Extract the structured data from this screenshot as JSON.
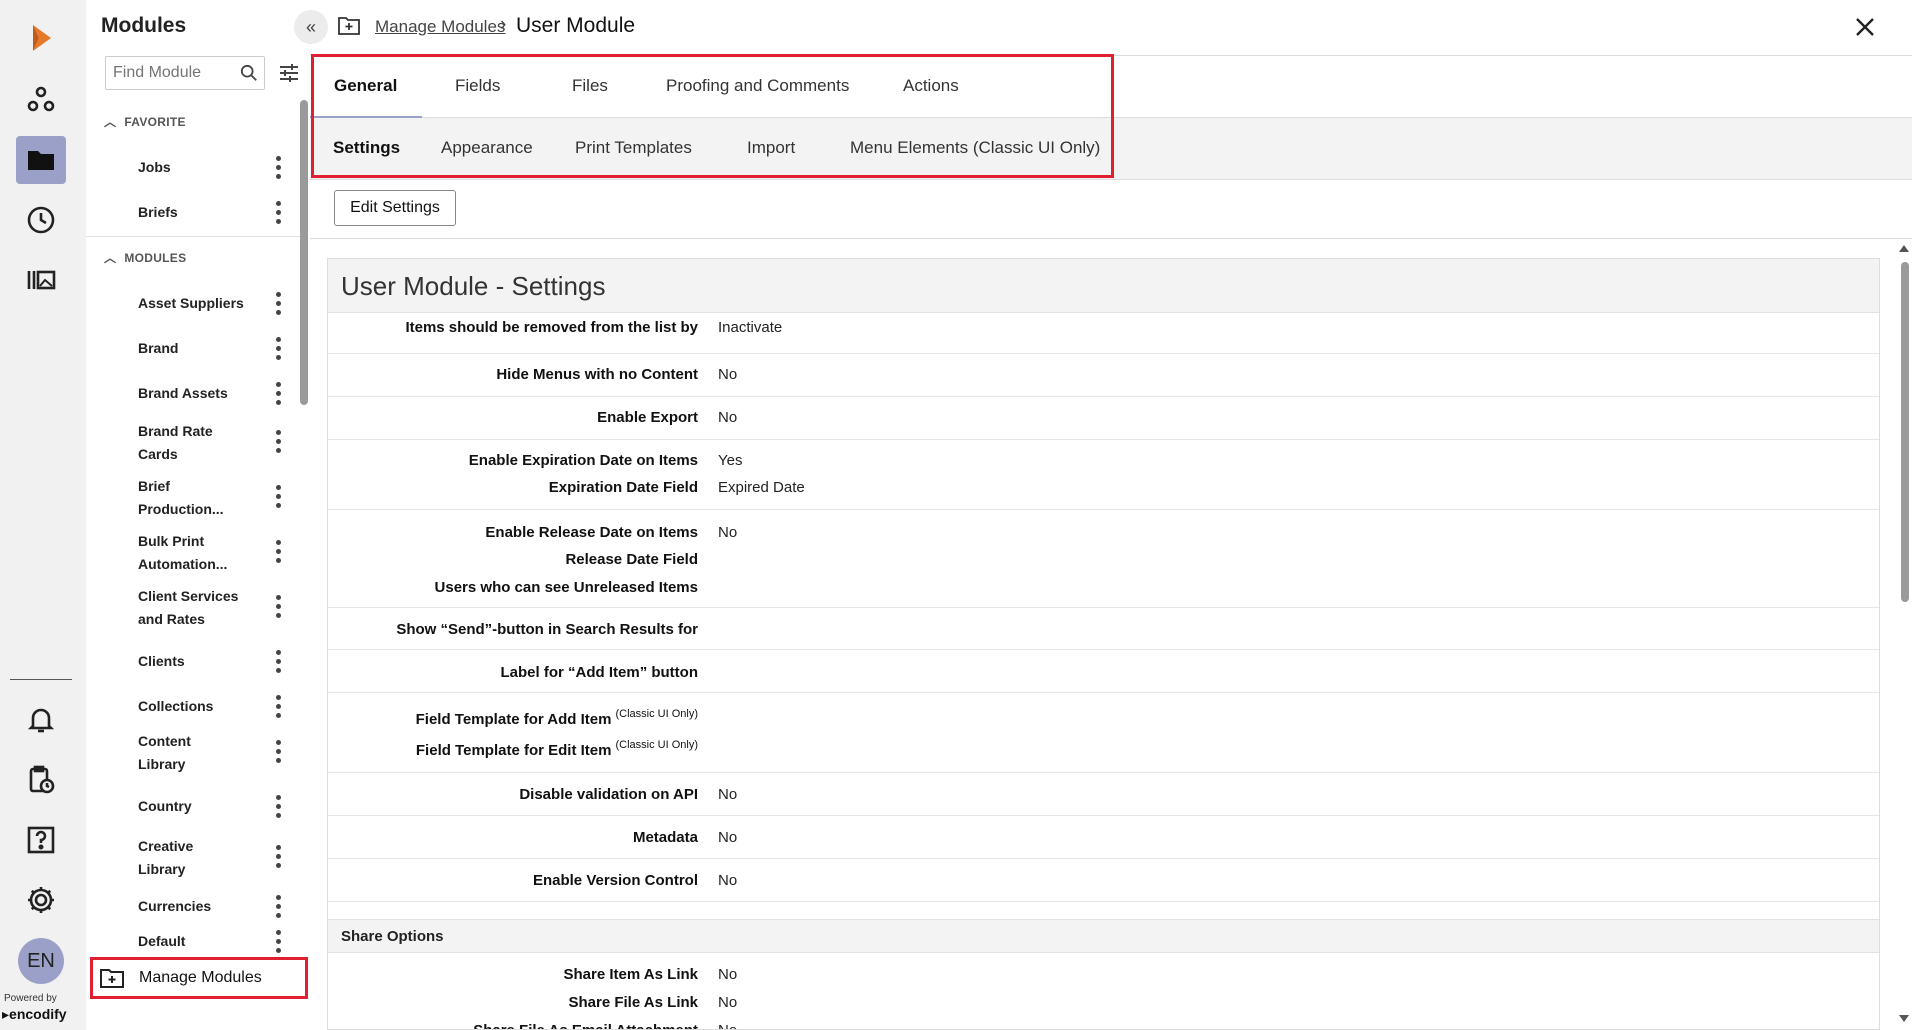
{
  "rail": {
    "avatar": "EN",
    "powered_by": "Powered by",
    "brand": "encodify"
  },
  "sidebar": {
    "title": "Modules",
    "search_placeholder": "Find Module",
    "favorite_header": "FAVORITE",
    "favorites": [
      "Jobs",
      "Briefs"
    ],
    "modules_header": "MODULES",
    "modules": [
      [
        "Asset Suppliers"
      ],
      [
        "Brand"
      ],
      [
        "Brand Assets"
      ],
      [
        "Brand Rate",
        "Cards"
      ],
      [
        "Brief",
        "Production..."
      ],
      [
        "Bulk Print",
        "Automation..."
      ],
      [
        "Client Services",
        "and Rates"
      ],
      [
        "Clients"
      ],
      [
        "Collections"
      ],
      [
        "Content",
        "Library"
      ],
      [
        "Country"
      ],
      [
        "Creative",
        "Library"
      ],
      [
        "Currencies"
      ],
      [
        "Default"
      ]
    ],
    "manage_modules": "Manage Modules"
  },
  "header": {
    "breadcrumb_link": "Manage Modules",
    "breadcrumb_sep": "›",
    "title": "User Module"
  },
  "tabs_primary": [
    "General",
    "Fields",
    "Files",
    "Proofing and Comments",
    "Actions"
  ],
  "tabs_secondary": [
    "Settings",
    "Appearance",
    "Print Templates",
    "Import",
    "Menu Elements (Classic UI Only)"
  ],
  "toolbar": {
    "edit_settings": "Edit Settings"
  },
  "panel": {
    "title": "User Module - Settings",
    "rows": [
      {
        "label": "Items should be removed from the list by",
        "value": "Inactivate"
      },
      {
        "label": "Hide Menus with no Content",
        "value": "No"
      },
      {
        "label": "Enable Export",
        "value": "No"
      },
      {
        "label": "Enable Expiration Date on Items",
        "value": "Yes"
      },
      {
        "label": "Expiration Date Field",
        "value": "Expired Date"
      },
      {
        "label": "Enable Release Date on Items",
        "value": "No"
      },
      {
        "label": "Release Date Field",
        "value": ""
      },
      {
        "label": "Users who can see Unreleased Items",
        "value": ""
      },
      {
        "label": "Show “Send”-button in Search Results for",
        "value": ""
      },
      {
        "label": "Label for “Add Item” button",
        "value": ""
      },
      {
        "label": "Field Template for Add Item",
        "sup": "(Classic UI Only)",
        "value": ""
      },
      {
        "label": "Field Template for Edit Item",
        "sup": "(Classic UI Only)",
        "value": ""
      },
      {
        "label": "Disable validation on API",
        "value": "No"
      },
      {
        "label": "Metadata",
        "value": "No"
      },
      {
        "label": "Enable Version Control",
        "value": "No"
      }
    ],
    "share_header": "Share Options",
    "share_rows": [
      {
        "label": "Share Item As Link",
        "value": "No"
      },
      {
        "label": "Share File As Link",
        "value": "No"
      },
      {
        "label": "Share File As Email Attachment",
        "value": "No"
      }
    ]
  },
  "colors": {
    "accent": "#9aa0c8",
    "highlight": "#e02030",
    "logo": "#e8782a"
  }
}
